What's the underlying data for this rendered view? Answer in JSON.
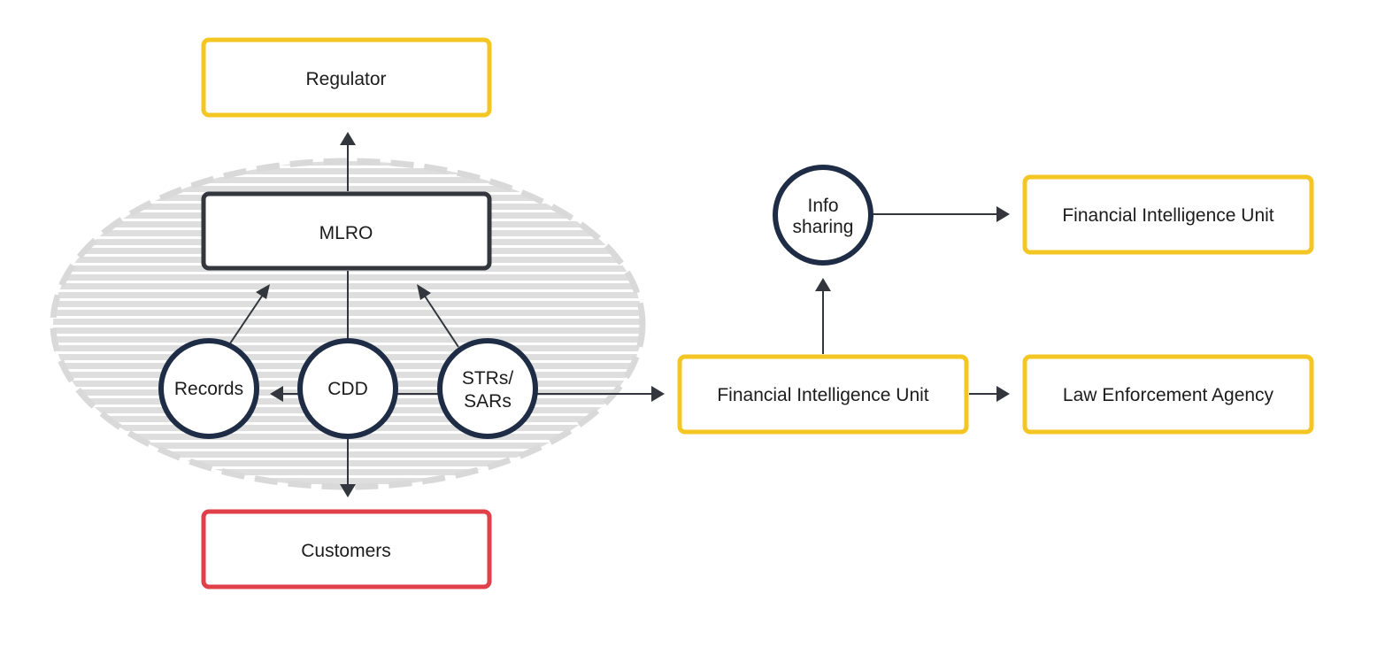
{
  "diagram": {
    "title": "",
    "boundary": {
      "label": "",
      "style": "hatched dashed ellipse",
      "color": "#D9D9D9"
    },
    "nodes": {
      "regulator": {
        "label": "Regulator",
        "shape": "box",
        "color": "#F4C623"
      },
      "mlro": {
        "label": "MLRO",
        "shape": "box",
        "color": "#33373D"
      },
      "records": {
        "label": "Records",
        "shape": "circle",
        "color": "#1E2D45"
      },
      "cdd": {
        "label": "CDD",
        "shape": "circle",
        "color": "#1E2D45"
      },
      "strs_sars": {
        "label_line1": "STRs/",
        "label_line2": "SARs",
        "shape": "circle",
        "color": "#1E2D45"
      },
      "customers": {
        "label": "Customers",
        "shape": "box",
        "color": "#E0404A"
      },
      "fiu_domestic": {
        "label": "Financial Intelligence Unit",
        "shape": "box",
        "color": "#F4C623"
      },
      "info_sharing": {
        "label_line1": "Info",
        "label_line2": "sharing",
        "shape": "circle",
        "color": "#1E2D45"
      },
      "fiu_foreign": {
        "label": "Financial Intelligence Unit",
        "shape": "box",
        "color": "#F4C623"
      },
      "law_enforcement": {
        "label": "Law Enforcement Agency",
        "shape": "box",
        "color": "#F4C623"
      }
    },
    "edges": [
      {
        "from": "mlro",
        "to": "regulator",
        "arrow": true
      },
      {
        "from": "cdd",
        "to": "mlro",
        "arrow": false
      },
      {
        "from": "records",
        "to": "mlro",
        "arrow": true
      },
      {
        "from": "strs_sars",
        "to": "mlro",
        "arrow": true
      },
      {
        "from": "cdd",
        "to": "records",
        "arrow": true
      },
      {
        "from": "cdd",
        "to": "strs_sars",
        "arrow": false
      },
      {
        "from": "cdd",
        "to": "customers",
        "arrow": true
      },
      {
        "from": "strs_sars",
        "to": "fiu_domestic",
        "arrow": true
      },
      {
        "from": "fiu_domestic",
        "to": "info_sharing",
        "arrow": true
      },
      {
        "from": "info_sharing",
        "to": "fiu_foreign",
        "arrow": true
      },
      {
        "from": "fiu_domestic",
        "to": "law_enforcement",
        "arrow": true
      }
    ]
  }
}
